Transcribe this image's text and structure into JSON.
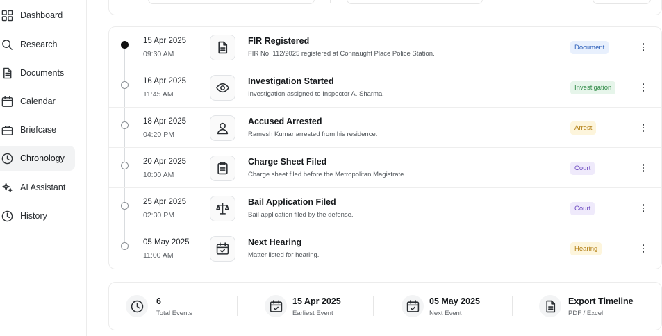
{
  "sidebar": {
    "items": [
      {
        "label": "Dashboard",
        "icon": "grid-icon",
        "active": false
      },
      {
        "label": "Research",
        "icon": "search-icon",
        "active": false
      },
      {
        "label": "Documents",
        "icon": "document-icon",
        "active": false
      },
      {
        "label": "Calendar",
        "icon": "calendar-icon",
        "active": false
      },
      {
        "label": "Briefcase",
        "icon": "briefcase-icon",
        "active": false
      },
      {
        "label": "Chronology",
        "icon": "clock-icon",
        "active": true
      },
      {
        "label": "AI Assistant",
        "icon": "sparkles-icon",
        "active": false
      },
      {
        "label": "History",
        "icon": "history-icon",
        "active": false
      }
    ]
  },
  "timeline": {
    "events": [
      {
        "date": "15 Apr 2025",
        "time": "09:30 AM",
        "title": "FIR Registered",
        "desc": "FIR No. 112/2025 registered at Connaught Place Police Station.",
        "badge": "Document",
        "icon": "document-icon",
        "current": true
      },
      {
        "date": "16 Apr 2025",
        "time": "11:45 AM",
        "title": "Investigation Started",
        "desc": "Investigation assigned to Inspector A. Sharma.",
        "badge": "Investigation",
        "icon": "eye-icon",
        "current": false
      },
      {
        "date": "18 Apr 2025",
        "time": "04:20 PM",
        "title": "Accused Arrested",
        "desc": "Ramesh Kumar arrested from his residence.",
        "badge": "Arrest",
        "icon": "user-icon",
        "current": false
      },
      {
        "date": "20 Apr 2025",
        "time": "10:00 AM",
        "title": "Charge Sheet Filed",
        "desc": "Charge sheet filed before the Metropolitan Magistrate.",
        "badge": "Court",
        "icon": "clipboard-icon",
        "current": false
      },
      {
        "date": "25 Apr 2025",
        "time": "02:30 PM",
        "title": "Bail Application Filed",
        "desc": "Bail application filed by the defense.",
        "badge": "Court",
        "icon": "scale-icon",
        "current": false
      },
      {
        "date": "05 May 2025",
        "time": "11:00 AM",
        "title": "Next Hearing",
        "desc": "Matter listed for hearing.",
        "badge": "Hearing",
        "icon": "calendar-check-icon",
        "current": false
      }
    ]
  },
  "summary": {
    "total": {
      "value": "6",
      "label": "Total Events",
      "icon": "clock-icon"
    },
    "earliest": {
      "value": "15 Apr 2025",
      "label": "Earliest Event",
      "icon": "calendar-check-icon"
    },
    "next": {
      "value": "05 May 2025",
      "label": "Next Event",
      "icon": "calendar-check-icon"
    },
    "export": {
      "value": "Export Timeline",
      "label": "PDF / Excel",
      "icon": "document-icon"
    }
  },
  "colors": {
    "document_badge": "#2a5db8",
    "investigation_badge": "#2f8a46",
    "arrest_badge": "#b17c10",
    "court_badge": "#6b48c0",
    "hearing_badge": "#b17c10"
  }
}
